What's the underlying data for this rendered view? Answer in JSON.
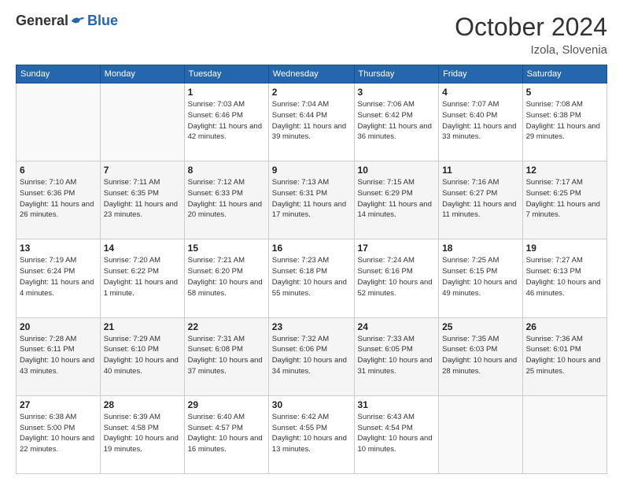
{
  "header": {
    "logo_general": "General",
    "logo_blue": "Blue",
    "month_title": "October 2024",
    "location": "Izola, Slovenia"
  },
  "weekdays": [
    "Sunday",
    "Monday",
    "Tuesday",
    "Wednesday",
    "Thursday",
    "Friday",
    "Saturday"
  ],
  "weeks": [
    [
      {
        "day": "",
        "info": ""
      },
      {
        "day": "",
        "info": ""
      },
      {
        "day": "1",
        "info": "Sunrise: 7:03 AM\nSunset: 6:46 PM\nDaylight: 11 hours and 42 minutes."
      },
      {
        "day": "2",
        "info": "Sunrise: 7:04 AM\nSunset: 6:44 PM\nDaylight: 11 hours and 39 minutes."
      },
      {
        "day": "3",
        "info": "Sunrise: 7:06 AM\nSunset: 6:42 PM\nDaylight: 11 hours and 36 minutes."
      },
      {
        "day": "4",
        "info": "Sunrise: 7:07 AM\nSunset: 6:40 PM\nDaylight: 11 hours and 33 minutes."
      },
      {
        "day": "5",
        "info": "Sunrise: 7:08 AM\nSunset: 6:38 PM\nDaylight: 11 hours and 29 minutes."
      }
    ],
    [
      {
        "day": "6",
        "info": "Sunrise: 7:10 AM\nSunset: 6:36 PM\nDaylight: 11 hours and 26 minutes."
      },
      {
        "day": "7",
        "info": "Sunrise: 7:11 AM\nSunset: 6:35 PM\nDaylight: 11 hours and 23 minutes."
      },
      {
        "day": "8",
        "info": "Sunrise: 7:12 AM\nSunset: 6:33 PM\nDaylight: 11 hours and 20 minutes."
      },
      {
        "day": "9",
        "info": "Sunrise: 7:13 AM\nSunset: 6:31 PM\nDaylight: 11 hours and 17 minutes."
      },
      {
        "day": "10",
        "info": "Sunrise: 7:15 AM\nSunset: 6:29 PM\nDaylight: 11 hours and 14 minutes."
      },
      {
        "day": "11",
        "info": "Sunrise: 7:16 AM\nSunset: 6:27 PM\nDaylight: 11 hours and 11 minutes."
      },
      {
        "day": "12",
        "info": "Sunrise: 7:17 AM\nSunset: 6:25 PM\nDaylight: 11 hours and 7 minutes."
      }
    ],
    [
      {
        "day": "13",
        "info": "Sunrise: 7:19 AM\nSunset: 6:24 PM\nDaylight: 11 hours and 4 minutes."
      },
      {
        "day": "14",
        "info": "Sunrise: 7:20 AM\nSunset: 6:22 PM\nDaylight: 11 hours and 1 minute."
      },
      {
        "day": "15",
        "info": "Sunrise: 7:21 AM\nSunset: 6:20 PM\nDaylight: 10 hours and 58 minutes."
      },
      {
        "day": "16",
        "info": "Sunrise: 7:23 AM\nSunset: 6:18 PM\nDaylight: 10 hours and 55 minutes."
      },
      {
        "day": "17",
        "info": "Sunrise: 7:24 AM\nSunset: 6:16 PM\nDaylight: 10 hours and 52 minutes."
      },
      {
        "day": "18",
        "info": "Sunrise: 7:25 AM\nSunset: 6:15 PM\nDaylight: 10 hours and 49 minutes."
      },
      {
        "day": "19",
        "info": "Sunrise: 7:27 AM\nSunset: 6:13 PM\nDaylight: 10 hours and 46 minutes."
      }
    ],
    [
      {
        "day": "20",
        "info": "Sunrise: 7:28 AM\nSunset: 6:11 PM\nDaylight: 10 hours and 43 minutes."
      },
      {
        "day": "21",
        "info": "Sunrise: 7:29 AM\nSunset: 6:10 PM\nDaylight: 10 hours and 40 minutes."
      },
      {
        "day": "22",
        "info": "Sunrise: 7:31 AM\nSunset: 6:08 PM\nDaylight: 10 hours and 37 minutes."
      },
      {
        "day": "23",
        "info": "Sunrise: 7:32 AM\nSunset: 6:06 PM\nDaylight: 10 hours and 34 minutes."
      },
      {
        "day": "24",
        "info": "Sunrise: 7:33 AM\nSunset: 6:05 PM\nDaylight: 10 hours and 31 minutes."
      },
      {
        "day": "25",
        "info": "Sunrise: 7:35 AM\nSunset: 6:03 PM\nDaylight: 10 hours and 28 minutes."
      },
      {
        "day": "26",
        "info": "Sunrise: 7:36 AM\nSunset: 6:01 PM\nDaylight: 10 hours and 25 minutes."
      }
    ],
    [
      {
        "day": "27",
        "info": "Sunrise: 6:38 AM\nSunset: 5:00 PM\nDaylight: 10 hours and 22 minutes."
      },
      {
        "day": "28",
        "info": "Sunrise: 6:39 AM\nSunset: 4:58 PM\nDaylight: 10 hours and 19 minutes."
      },
      {
        "day": "29",
        "info": "Sunrise: 6:40 AM\nSunset: 4:57 PM\nDaylight: 10 hours and 16 minutes."
      },
      {
        "day": "30",
        "info": "Sunrise: 6:42 AM\nSunset: 4:55 PM\nDaylight: 10 hours and 13 minutes."
      },
      {
        "day": "31",
        "info": "Sunrise: 6:43 AM\nSunset: 4:54 PM\nDaylight: 10 hours and 10 minutes."
      },
      {
        "day": "",
        "info": ""
      },
      {
        "day": "",
        "info": ""
      }
    ]
  ]
}
